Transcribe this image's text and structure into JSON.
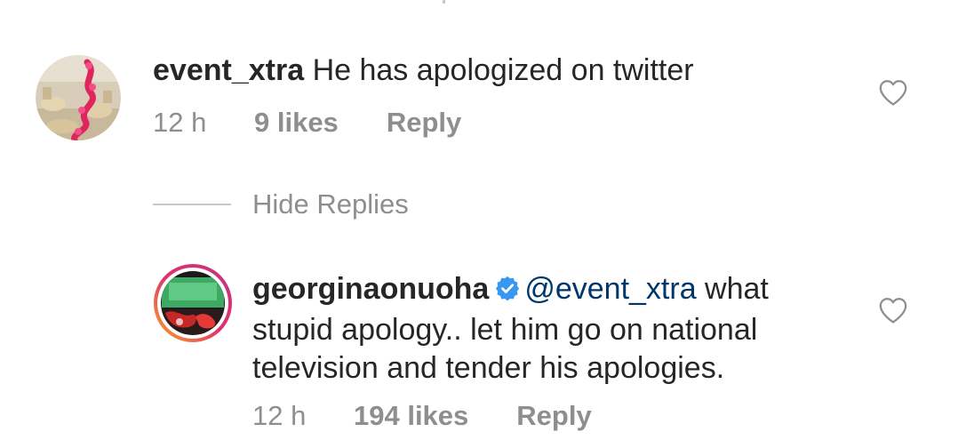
{
  "comments": [
    {
      "username": "event_xtra",
      "text": "He has apologized on twitter",
      "time": "12 h",
      "likes": "9 likes",
      "reply_label": "Reply",
      "verified": false
    }
  ],
  "hide_replies_label": "Hide Replies",
  "replies": [
    {
      "username": "georginaonuoha",
      "verified": true,
      "mention": "@event_xtra",
      "text_line1": " what",
      "text_line2": "stupid apology.. let him go on national",
      "text_line3": "television and tender his apologies.",
      "time": "12 h",
      "likes": "194 likes",
      "reply_label": "Reply"
    }
  ],
  "icons": {
    "like": "heart-outline-icon",
    "verified": "verified-badge-icon"
  },
  "colors": {
    "text_primary": "#262626",
    "text_secondary": "#8e8e8e",
    "mention": "#00376b",
    "verified_blue": "#3897f0",
    "divider": "#c7c7c7"
  }
}
